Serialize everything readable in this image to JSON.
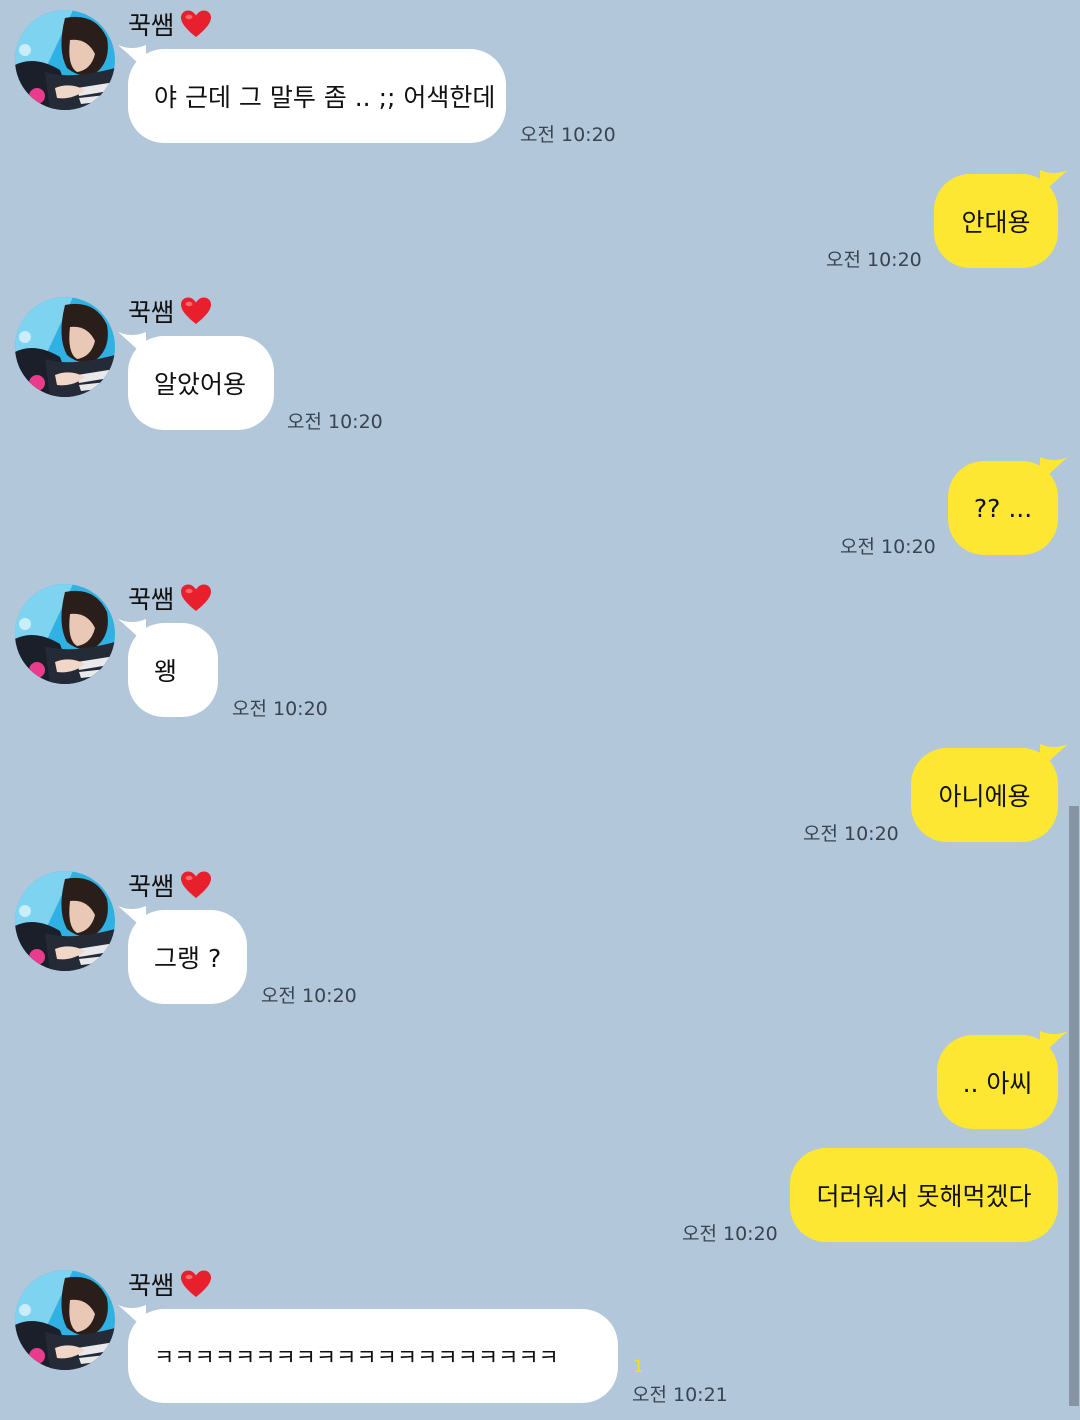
{
  "sender_name": "꾹쌤",
  "messages": [
    {
      "text": "야 근데 그 말투 좀 .. ;; 어색한데",
      "time": "오전 10:20"
    },
    {
      "text": "안대용",
      "time": "오전 10:20"
    },
    {
      "text": "알았어용",
      "time": "오전 10:20"
    },
    {
      "text": "?? ...",
      "time": "오전 10:20"
    },
    {
      "text": "왱",
      "time": "오전 10:20"
    },
    {
      "text": "아니에용",
      "time": "오전 10:20"
    },
    {
      "text": "그랭 ?",
      "time": "오전 10:20"
    },
    {
      "text": ".. 아씨",
      "time": ""
    },
    {
      "text": "더러워서 못해먹겠다",
      "time": "오전 10:20"
    },
    {
      "text": "ㅋㅋㅋㅋㅋㅋㅋㅋㅋㅋㅋㅋㅋㅋㅋㅋㅋㅋㅋㅋ",
      "time": "오전 10:21",
      "unread": "1"
    }
  ],
  "colors": {
    "background": "#b2c7da",
    "incoming_bubble": "#ffffff",
    "outgoing_bubble": "#fee733",
    "heart": "#e8202e",
    "unread_count": "#f4dd2b"
  },
  "icons": {
    "heart": "red-heart-emoji",
    "avatar": "profile-photo"
  }
}
